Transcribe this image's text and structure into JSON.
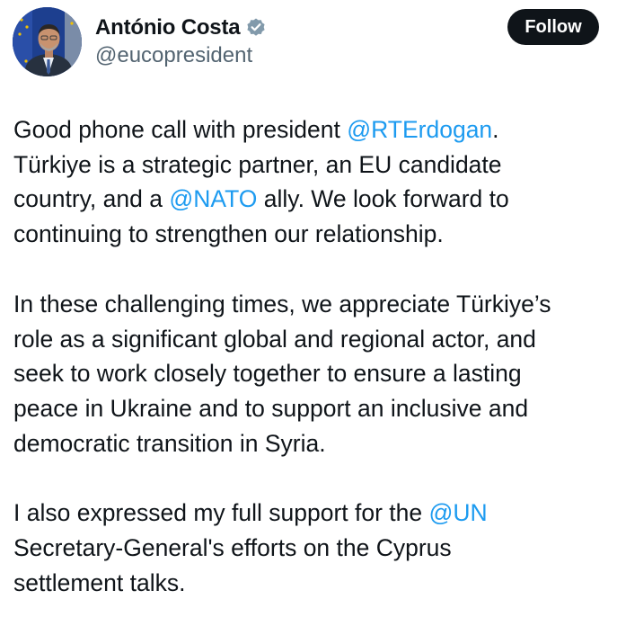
{
  "author": {
    "display_name": "António Costa",
    "handle": "@eucopresident",
    "verified": true,
    "avatar_icon": "profile-photo"
  },
  "follow_label": "Follow",
  "colors": {
    "text": "#0f1419",
    "secondary_text": "#536471",
    "mention": "#1d9bf0",
    "follow_button_bg": "#0f1419",
    "verified_badge": "#829aab"
  },
  "tweet": {
    "p1": {
      "l1_a": "Good phone call with president ",
      "l1_mention": "@RTErdogan",
      "l1_b": ".",
      "l2": "Türkiye is a strategic partner, an EU candidate",
      "l3_a": "country, and a ",
      "l3_mention": "@NATO",
      "l3_b": " ally. We look forward to",
      "l4": "continuing to strengthen our relationship."
    },
    "p2": {
      "l1": "In these challenging times, we appreciate Türkiye’s",
      "l2": "role as a significant global and regional actor, and",
      "l3": "seek to work closely together to ensure a lasting",
      "l4": "peace in Ukraine and to support an inclusive and",
      "l5": "democratic transition in Syria."
    },
    "p3": {
      "l1_a": "I also expressed my full support for the ",
      "l1_mention": "@UN",
      "l2": "Secretary-General's efforts on the Cyprus",
      "l3": "settlement talks."
    }
  }
}
